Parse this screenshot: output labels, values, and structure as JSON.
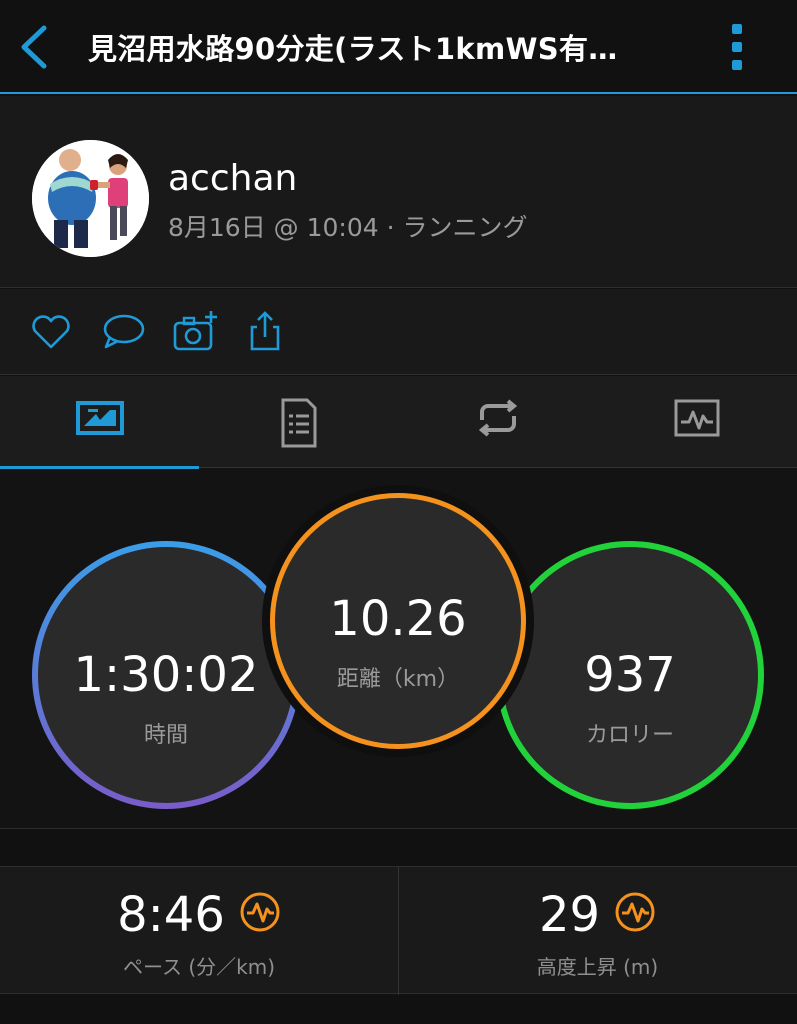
{
  "header": {
    "title": "見沼用水路90分走(ラスト1kmWS有…",
    "back_icon": "chevron-left-icon",
    "menu_icon": "kebab-menu-icon"
  },
  "profile": {
    "username": "acchan",
    "meta": "8月16日 @ 10:04 · ランニング"
  },
  "actions": [
    "heart-icon",
    "comment-icon",
    "add-photo-icon",
    "share-icon"
  ],
  "tabs": [
    {
      "name": "overview",
      "icon": "overview-icon",
      "active": true
    },
    {
      "name": "details",
      "icon": "document-icon",
      "active": false
    },
    {
      "name": "laps",
      "icon": "loop-icon",
      "active": false
    },
    {
      "name": "charts",
      "icon": "chart-icon",
      "active": false
    }
  ],
  "stats": {
    "time": {
      "value": "1:30:02",
      "label": "時間"
    },
    "distance": {
      "value": "10.26",
      "label": "距離（km）"
    },
    "calories": {
      "value": "937",
      "label": "カロリー"
    }
  },
  "bottom": {
    "pace": {
      "value": "8:46",
      "label": "ペース (分／km)"
    },
    "elevation": {
      "value": "29",
      "label": "高度上昇 (m)"
    }
  },
  "colors": {
    "accent": "#1f9ad6",
    "time_ring_top": "#3a9ee8",
    "time_ring_bottom": "#7a5cc8",
    "distance_ring": "#f5921e",
    "calories_ring": "#22d23a",
    "badge": "#f5921e"
  }
}
